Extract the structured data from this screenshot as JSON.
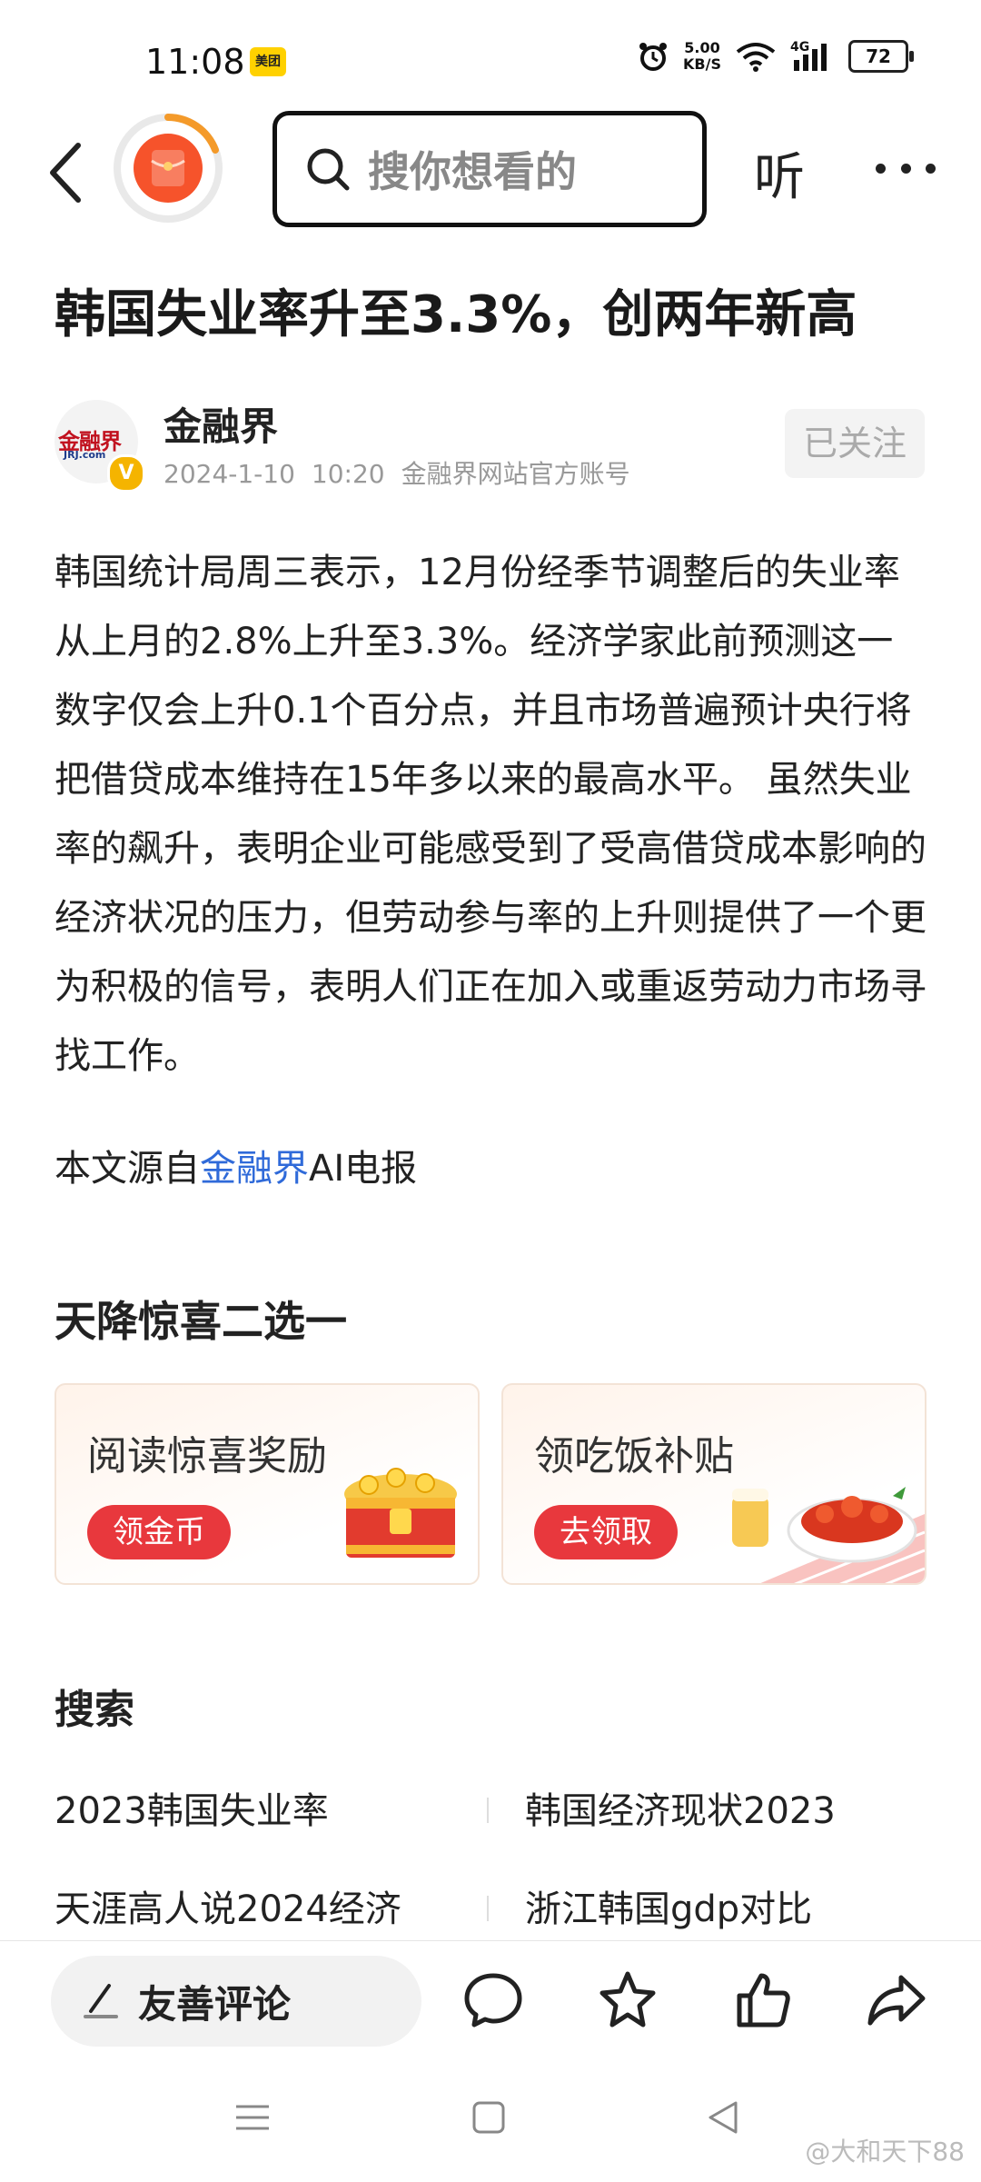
{
  "status_bar": {
    "time": "11:08",
    "app_badge": "美团",
    "net_speed_value": "5.00",
    "net_speed_unit": "KB/S",
    "signal_label": "4G",
    "battery": "72"
  },
  "header": {
    "search_placeholder": "搜你想看的",
    "listen_label": "听"
  },
  "article": {
    "title": "韩国失业率升至3.3%，创两年新高",
    "author": {
      "name": "金融界",
      "logo_text": "金融界",
      "logo_sub": "JRJ.com",
      "verified_badge": "V",
      "date": "2024-1-10",
      "time": "10:20",
      "description": "金融界网站官方账号"
    },
    "follow_label": "已关注",
    "body": "韩国统计局周三表示，12月份经季节调整后的失业率从上月的2.8%上升至3.3%。经济学家此前预测这一数字仅会上升0.1个百分点，并且市场普遍预计央行将把借贷成本维持在15年多以来的最高水平。 虽然失业率的飙升，表明企业可能感受到了受高借贷成本影响的经济状况的压力，但劳动参与率的上升则提供了一个更为积极的信号，表明人们正在加入或重返劳动力市场寻找工作。",
    "source_prefix": "本文源自",
    "source_link": "金融界",
    "source_suffix": "AI电报"
  },
  "promo": {
    "title": "天降惊喜二选一",
    "cards": [
      {
        "title": "阅读惊喜奖励",
        "button": "领金币"
      },
      {
        "title": "领吃饭补贴",
        "button": "去领取"
      }
    ]
  },
  "search_section": {
    "title": "搜索",
    "queries": [
      "2023韩国失业率",
      "韩国经济现状2023",
      "天涯高人说2024经济",
      "浙江韩国gdp对比"
    ]
  },
  "bottom_bar": {
    "comment_placeholder": "友善评论"
  },
  "watermark": "@大和天下88",
  "colors": {
    "accent_red": "#e8383d",
    "link_blue": "#2f6ad9",
    "logo_orange": "#f6532b"
  }
}
